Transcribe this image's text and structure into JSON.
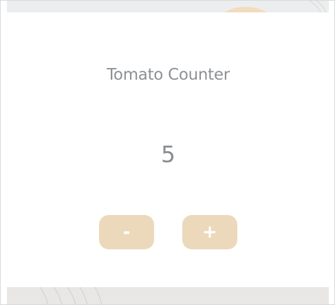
{
  "app": {
    "title": "Tomato Counter"
  },
  "counter": {
    "value": "5"
  },
  "controls": {
    "decrement_label": "-",
    "increment_label": "+"
  },
  "colors": {
    "button_background": "#ecd9bb",
    "text_gray": "#8d9094",
    "banner_top": "#ecedee",
    "banner_bottom": "#e9e6e6"
  }
}
